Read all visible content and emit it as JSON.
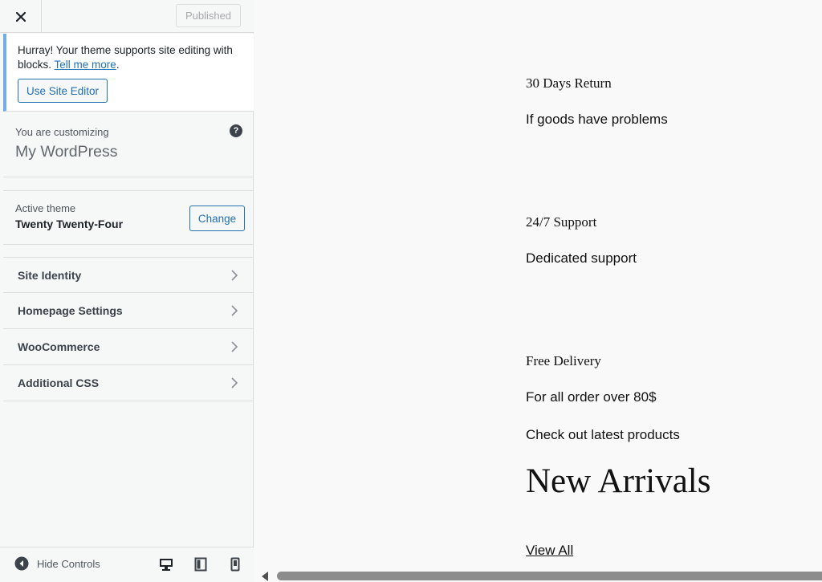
{
  "header": {
    "publish_label": "Published"
  },
  "notice": {
    "text": "Hurray! Your theme supports site editing with blocks.",
    "link": "Tell me more",
    "period": ".",
    "button": "Use Site Editor"
  },
  "customizing": {
    "label": "You are customizing",
    "site": "My WordPress"
  },
  "theme": {
    "label": "Active theme",
    "name": "Twenty Twenty-Four",
    "change": "Change"
  },
  "sections": [
    {
      "label": "Site Identity"
    },
    {
      "label": "Homepage Settings"
    },
    {
      "label": "WooCommerce"
    },
    {
      "label": "Additional CSS"
    }
  ],
  "footer": {
    "hide_controls": "Hide Controls"
  },
  "preview": {
    "feature1_title": "30 Days Return",
    "feature1_text": "If goods have problems",
    "feature2_title": "24/7 Support",
    "feature2_text": "Dedicated support",
    "feature3_title": "Free Delivery",
    "feature3_text": "For all order over 80$",
    "latest": "Check out latest products",
    "heading": "New Arrivals",
    "view_all": "View All"
  },
  "colors": {
    "accent": "#2271b1",
    "notice_border": "#72aee6"
  },
  "icons": [
    "close-icon",
    "help-icon",
    "chevron-right-icon",
    "hide-controls-icon",
    "desktop-icon",
    "tablet-icon",
    "mobile-icon"
  ]
}
